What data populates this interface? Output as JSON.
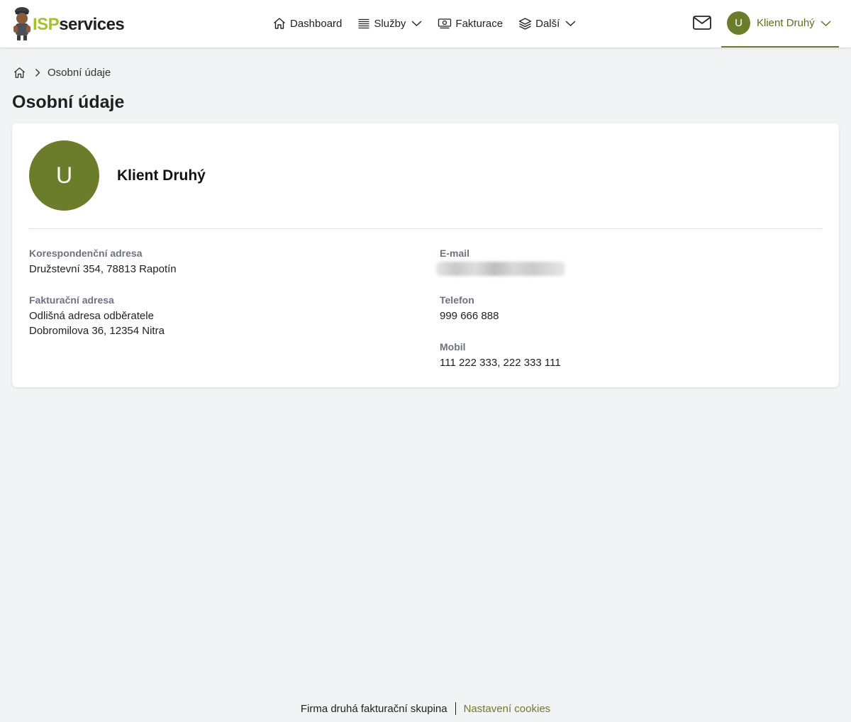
{
  "header": {
    "logo": {
      "part1": "ISP",
      "part2": "services"
    },
    "nav": [
      {
        "label": "Dashboard",
        "icon": "home-icon",
        "has_dropdown": false
      },
      {
        "label": "Služby",
        "icon": "list-icon",
        "has_dropdown": true
      },
      {
        "label": "Fakturace",
        "icon": "banknote-icon",
        "has_dropdown": false
      },
      {
        "label": "Další",
        "icon": "layers-icon",
        "has_dropdown": true
      }
    ],
    "mail_icon": "mail-icon",
    "user": {
      "initial": "U",
      "name": "Klient Druhý"
    }
  },
  "breadcrumb": {
    "home_icon": "home-icon",
    "current": "Osobní údaje"
  },
  "page_title": "Osobní údaje",
  "profile": {
    "initial": "U",
    "name": "Klient Druhý",
    "left_fields": [
      {
        "label": "Korespondenční adresa",
        "lines": [
          "Družstevní 354, 78813 Rapotín"
        ]
      },
      {
        "label": "Fakturační adresa",
        "lines": [
          "Odlišná adresa odběratele",
          "Dobromilova 36, 12354 Nitra"
        ]
      }
    ],
    "right_fields": [
      {
        "label": "E-mail",
        "lines": []
      },
      {
        "label": "Telefon",
        "lines": [
          "999 666 888"
        ]
      },
      {
        "label": "Mobil",
        "lines": [
          "111 222 333, 222 333 111"
        ]
      }
    ]
  },
  "footer": {
    "company": "Firma druhá fakturační skupina",
    "cookies": "Nastavení cookies"
  },
  "colors": {
    "accent": "#6b7d2a",
    "logo_green": "#a6c12c",
    "background": "#f2f3f5"
  }
}
